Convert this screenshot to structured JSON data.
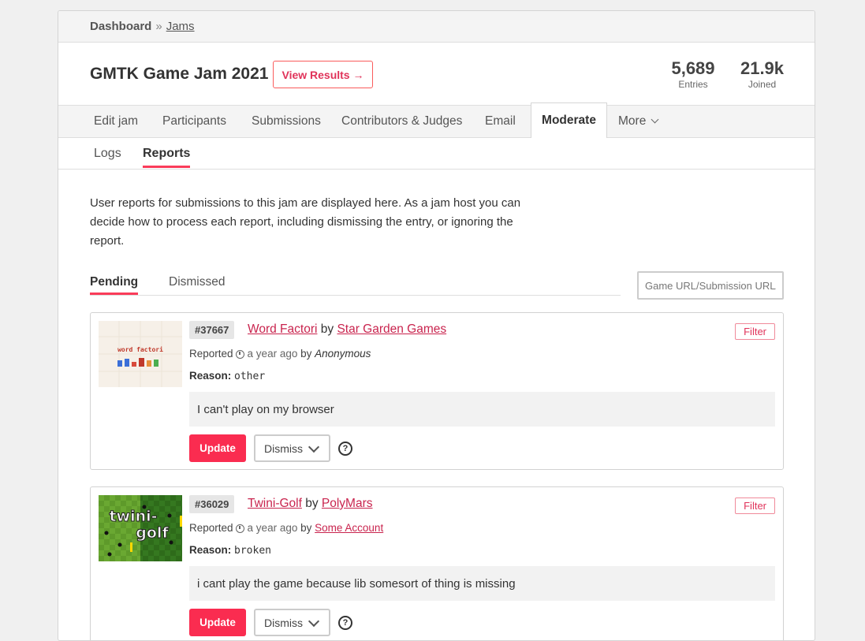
{
  "breadcrumb": {
    "root": "Dashboard",
    "separator": "»",
    "link": "Jams"
  },
  "header": {
    "title": "GMTK Game Jam 2021",
    "view_results": "View Results →",
    "stats": [
      {
        "value": "5,689",
        "label": "Entries"
      },
      {
        "value": "21.9k",
        "label": "Joined"
      }
    ]
  },
  "tabs": [
    {
      "label": "Edit jam"
    },
    {
      "label": "Participants"
    },
    {
      "label": "Submissions"
    },
    {
      "label": "Contributors & Judges"
    },
    {
      "label": "Email"
    },
    {
      "label": "Moderate",
      "active": true
    },
    {
      "label": "More"
    }
  ],
  "subtabs": [
    {
      "label": "Logs"
    },
    {
      "label": "Reports",
      "active": true
    }
  ],
  "intro": "User reports for submissions to this jam are displayed here. As a jam host you can decide how to process each report, including dismissing the entry, or ignoring the report.",
  "filter_tabs": [
    {
      "label": "Pending",
      "active": true
    },
    {
      "label": "Dismissed"
    }
  ],
  "search": {
    "placeholder": "Game URL/Submission URL/"
  },
  "reports": [
    {
      "id": "#37667",
      "game": "Word Factori",
      "by": "by",
      "author": "Star Garden Games",
      "filter_label": "Filter",
      "reported_label": "Reported",
      "time": "a year ago",
      "reporter_by": "by",
      "reporter": "Anonymous",
      "reason_label": "Reason:",
      "reason": "other",
      "message": "I can't play on my browser",
      "update_label": "Update",
      "dismiss_label": "Dismiss",
      "help_label": "?",
      "thumb_text": "word factori"
    },
    {
      "id": "#36029",
      "game": "Twini-Golf",
      "by": "by",
      "author": "PolyMars",
      "filter_label": "Filter",
      "reported_label": "Reported",
      "time": "a year ago",
      "reporter_by": "by",
      "reporter": "Some Account",
      "reason_label": "Reason:",
      "reason": "broken",
      "message": "i cant play the game because lib somesort of thing is missing",
      "update_label": "Update",
      "dismiss_label": "Dismiss",
      "help_label": "?",
      "thumb_text_1": "twini-",
      "thumb_text_2": "golf"
    }
  ],
  "colors": {
    "accent": "#fa2c50",
    "link": "#c9244e"
  }
}
